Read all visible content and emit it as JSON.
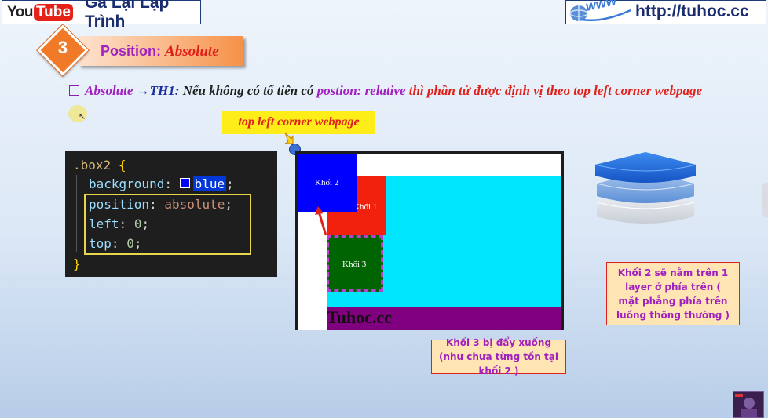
{
  "header": {
    "youtube_you": "You",
    "youtube_tube": "Tube",
    "channel_name": "Gà Lại Lập Trình",
    "site_url": "http://tuhoc.cc",
    "www_icon": "www-globe-icon"
  },
  "section": {
    "number": "3",
    "title_prefix": "Position:",
    "title_value": "Absolute"
  },
  "bullet": {
    "part_absolute": "Absolute",
    "part_arrow": "→",
    "part_case": "TH1:",
    "part_text1": "Nếu không có tổ tiên có",
    "part_position": "postion: relative",
    "part_text2": "thì phần tử được định vị theo top left corner webpage"
  },
  "callout": {
    "label": "top left corner webpage"
  },
  "code": {
    "selector": ".box2",
    "open_brace": "{",
    "close_brace": "}",
    "line_background_prop": "background",
    "line_background_value": "blue",
    "line_position_prop": "position",
    "line_position_value": "absolute",
    "line_left_prop": "left",
    "line_left_value": "0",
    "line_top_prop": "top",
    "line_top_value": "0",
    "colon": ":",
    "semicolon": ";"
  },
  "demo": {
    "block1_label": "Khối 1",
    "block2_label": "Khối 2",
    "block3_label": "Khối 3",
    "footer_text": "Tuhoc.cc",
    "colors": {
      "block1": "#f2210e",
      "block2": "#0000ff",
      "block3": "#006400",
      "cyan": "#00e6ff",
      "footer": "#800080"
    }
  },
  "notes": {
    "note1": "Khối 2 sẽ nằm trên 1 layer ở phía trên ( mặt phẳng phía trên luồng thông thường )",
    "note2": "Khối 3 bị đẩy xuống (như chưa từng tồn tại khối 2 )"
  },
  "icons": {
    "layers": "stacked-layers-icon",
    "avatar": "presenter-avatar",
    "cursor": "mouse-cursor-icon"
  }
}
